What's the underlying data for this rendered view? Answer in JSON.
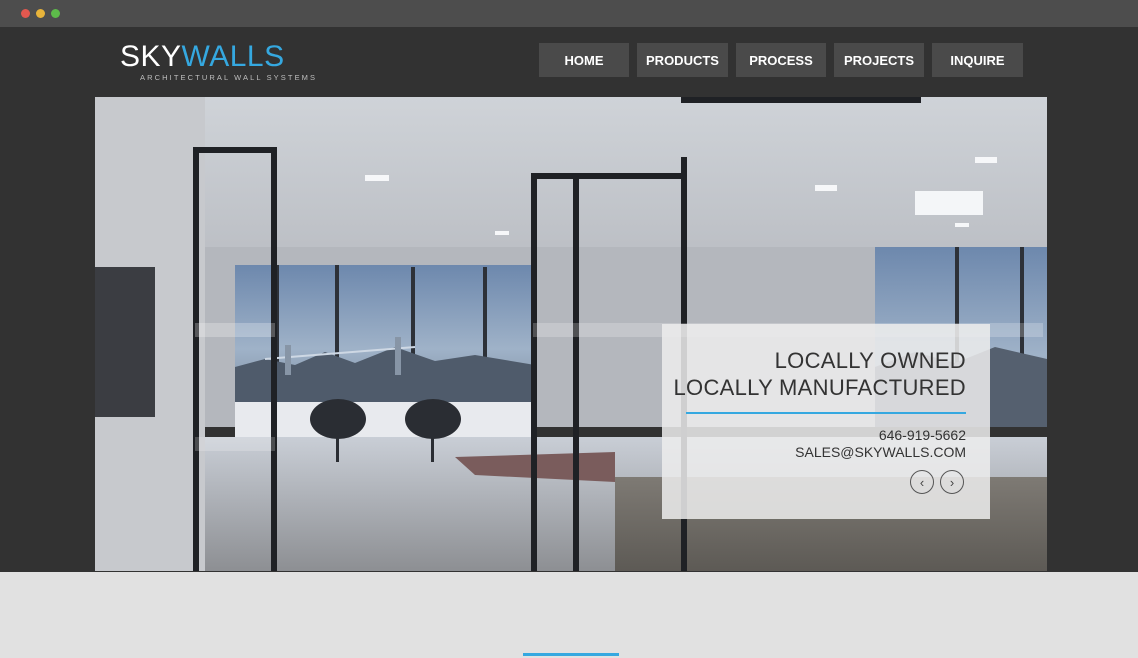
{
  "brand": {
    "name_part1": "SKY",
    "name_part2": "WALLS",
    "tagline": "ARCHITECTURAL WALL SYSTEMS",
    "accent_color": "#35a8e0"
  },
  "nav": {
    "items": [
      {
        "label": "HOME"
      },
      {
        "label": "PRODUCTS"
      },
      {
        "label": "PROCESS"
      },
      {
        "label": "PROJECTS"
      },
      {
        "label": "INQUIRE"
      }
    ]
  },
  "hero": {
    "caption_line1": "LOCALLY OWNED",
    "caption_line2": "LOCALLY MANUFACTURED",
    "phone": "646-919-5662",
    "email": "SALES@SKYWALLS.COM",
    "prev_icon": "chevron-left-icon",
    "next_icon": "chevron-right-icon"
  }
}
